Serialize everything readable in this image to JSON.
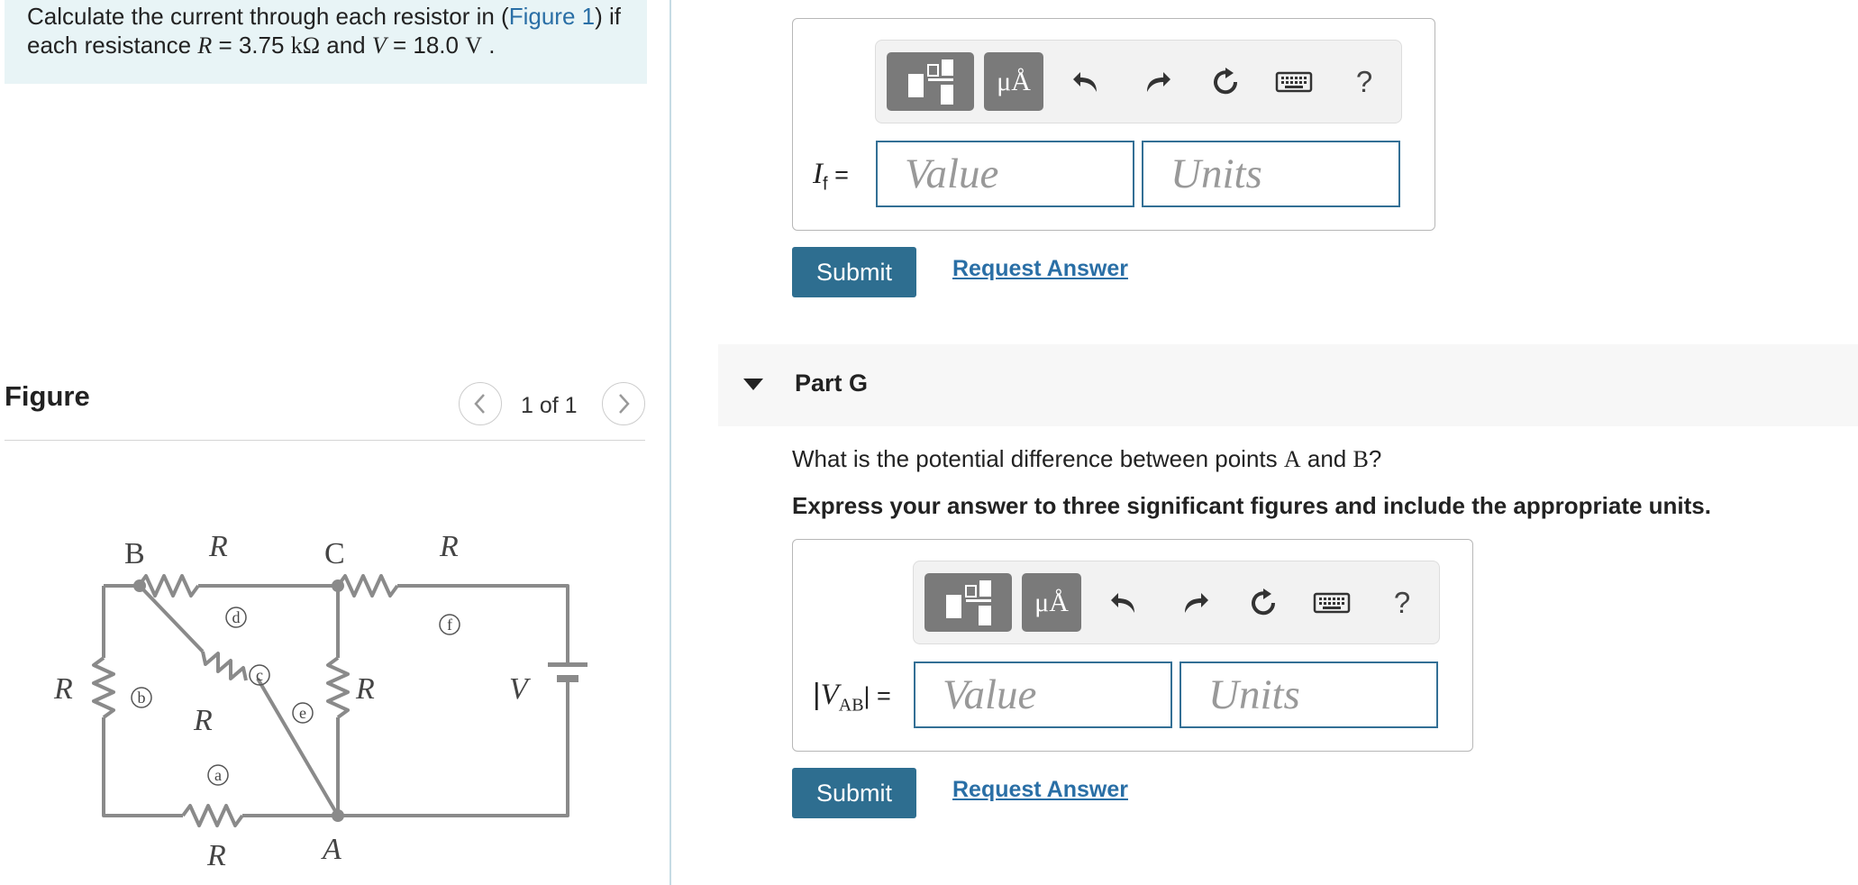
{
  "problem": {
    "line1_pre": "Calculate the current through each resistor in (",
    "figure_link": "Figure 1",
    "line1_post": ") if",
    "line2_pre": "each resistance ",
    "R_sym": "R",
    "R_val": " = 3.75  ",
    "R_unit": "kΩ",
    "and": " and ",
    "V_sym": "V",
    "V_val": " = 18.0  ",
    "V_unit": "V",
    "end": " ."
  },
  "figure": {
    "title": "Figure",
    "page_indicator": "1 of 1",
    "prev_glyph": "<",
    "next_glyph": ">",
    "circuit_labels": {
      "B": "B",
      "C": "C",
      "A": "A",
      "R": "R",
      "V": "V",
      "a": "a",
      "b": "b",
      "c": "c",
      "d": "d",
      "e": "e",
      "f": "f"
    }
  },
  "toolbar": {
    "units_button": "μÅ",
    "help": "?",
    "icons": [
      "templates-icon",
      "units-icon",
      "undo-icon",
      "redo-icon",
      "reset-icon",
      "keyboard-icon",
      "help-icon"
    ]
  },
  "part_f": {
    "var_main": "I",
    "var_sub": "f",
    "equals": " =",
    "value_placeholder": "Value",
    "units_placeholder": "Units",
    "submit": "Submit",
    "request": "Request Answer"
  },
  "part_g": {
    "title": "Part G",
    "question_pre": "What is the potential difference between points ",
    "point_a": "A",
    "and": " and ",
    "point_b": "B",
    "question_post": "?",
    "instruction": "Express your answer to three significant figures and include the appropriate units.",
    "var_bar": "|",
    "var_main": "V",
    "var_sub": "AB",
    "equals": "| =",
    "value_placeholder": "Value",
    "units_placeholder": "Units",
    "submit": "Submit",
    "request": "Request Answer"
  },
  "colors": {
    "problem_bg": "#e8f4f6",
    "link": "#2a6fa6",
    "submit_bg": "#2e6e90",
    "field_border": "#336f95",
    "circuit": "#8a8a8a"
  }
}
